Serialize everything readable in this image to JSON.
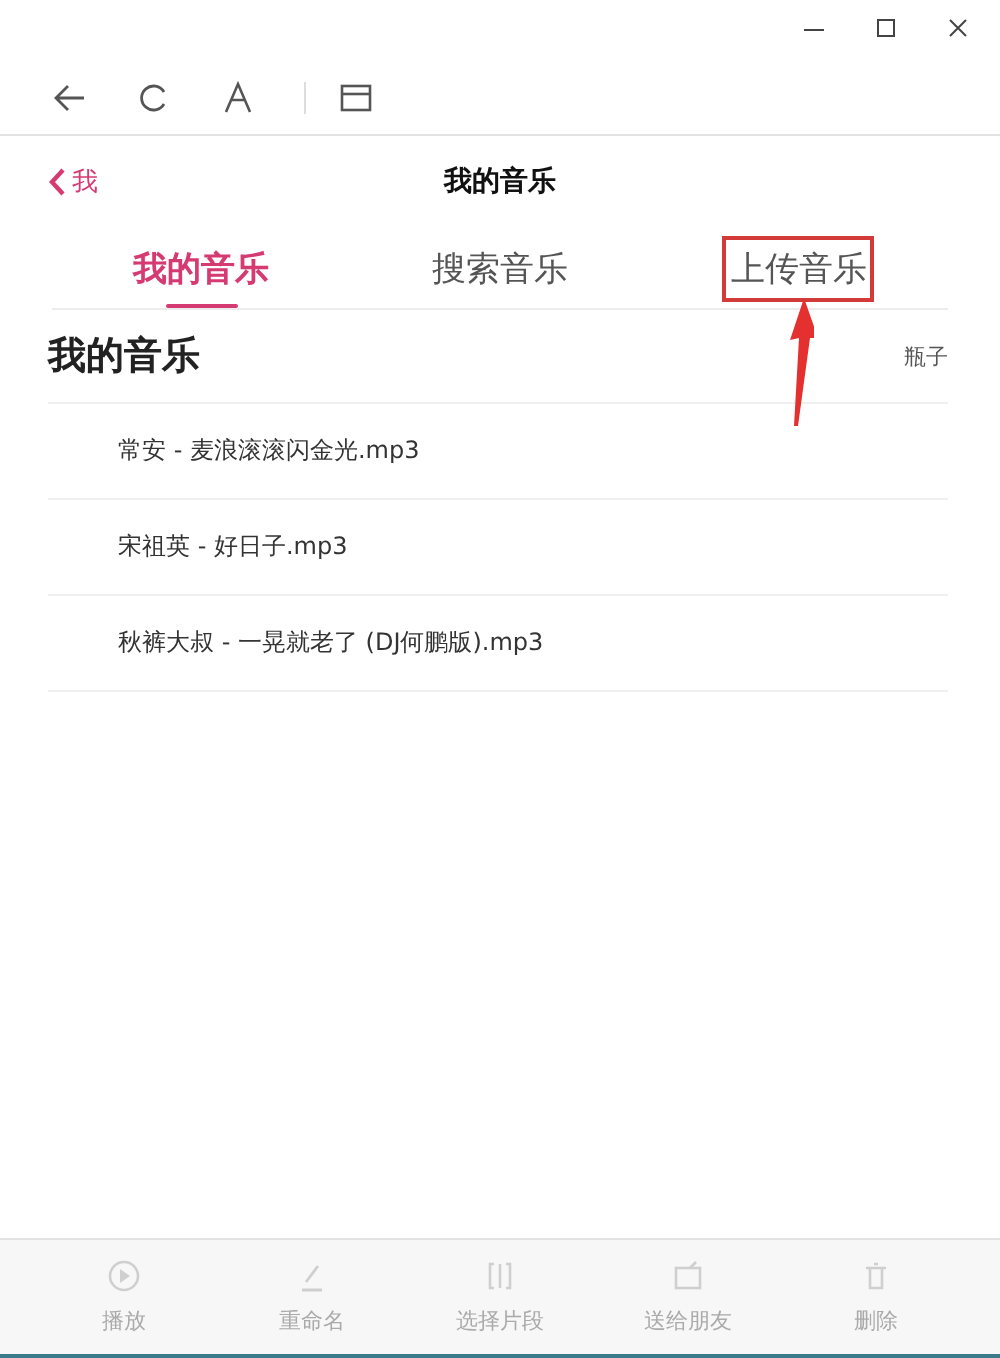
{
  "header": {
    "back_label": "我",
    "title": "我的音乐"
  },
  "tabs": [
    {
      "label": "我的音乐",
      "selected": true
    },
    {
      "label": "搜索音乐",
      "selected": false
    },
    {
      "label": "上传音乐",
      "selected": false,
      "highlighted": true
    }
  ],
  "section": {
    "title": "我的音乐",
    "user": "瓶子"
  },
  "songs": [
    "常安 - 麦浪滚滚闪金光.mp3",
    "宋祖英 - 好日子.mp3",
    "秋裤大叔 - 一晃就老了 (DJ何鹏版).mp3"
  ],
  "actions": [
    {
      "label": "播放",
      "kind": "play",
      "disabled": true
    },
    {
      "label": "重命名",
      "kind": "rename",
      "disabled": true
    },
    {
      "label": "选择片段",
      "kind": "clip",
      "disabled": true
    },
    {
      "label": "送给朋友",
      "kind": "share",
      "disabled": true
    },
    {
      "label": "删除",
      "kind": "delete",
      "disabled": true
    }
  ]
}
